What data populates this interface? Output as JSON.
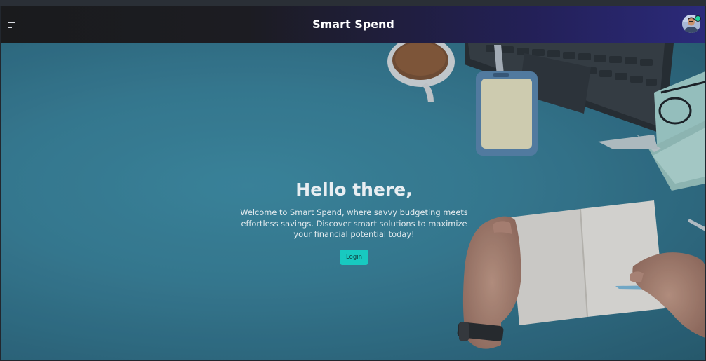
{
  "navbar": {
    "title": "Smart Spend",
    "menu_icon": "hamburger-menu-icon",
    "avatar": "user-avatar",
    "status": "online"
  },
  "hero": {
    "heading": "Hello there,",
    "description": "Welcome to Smart Spend, where savvy budgeting meets effortless savings. Discover smart solutions to maximize your financial potential today!",
    "login_label": "Login"
  },
  "colors": {
    "accent": "#18c9c0",
    "navbar_start": "#1a1b1d",
    "navbar_end": "#2b2a7a",
    "status_online": "#20d3a0"
  }
}
